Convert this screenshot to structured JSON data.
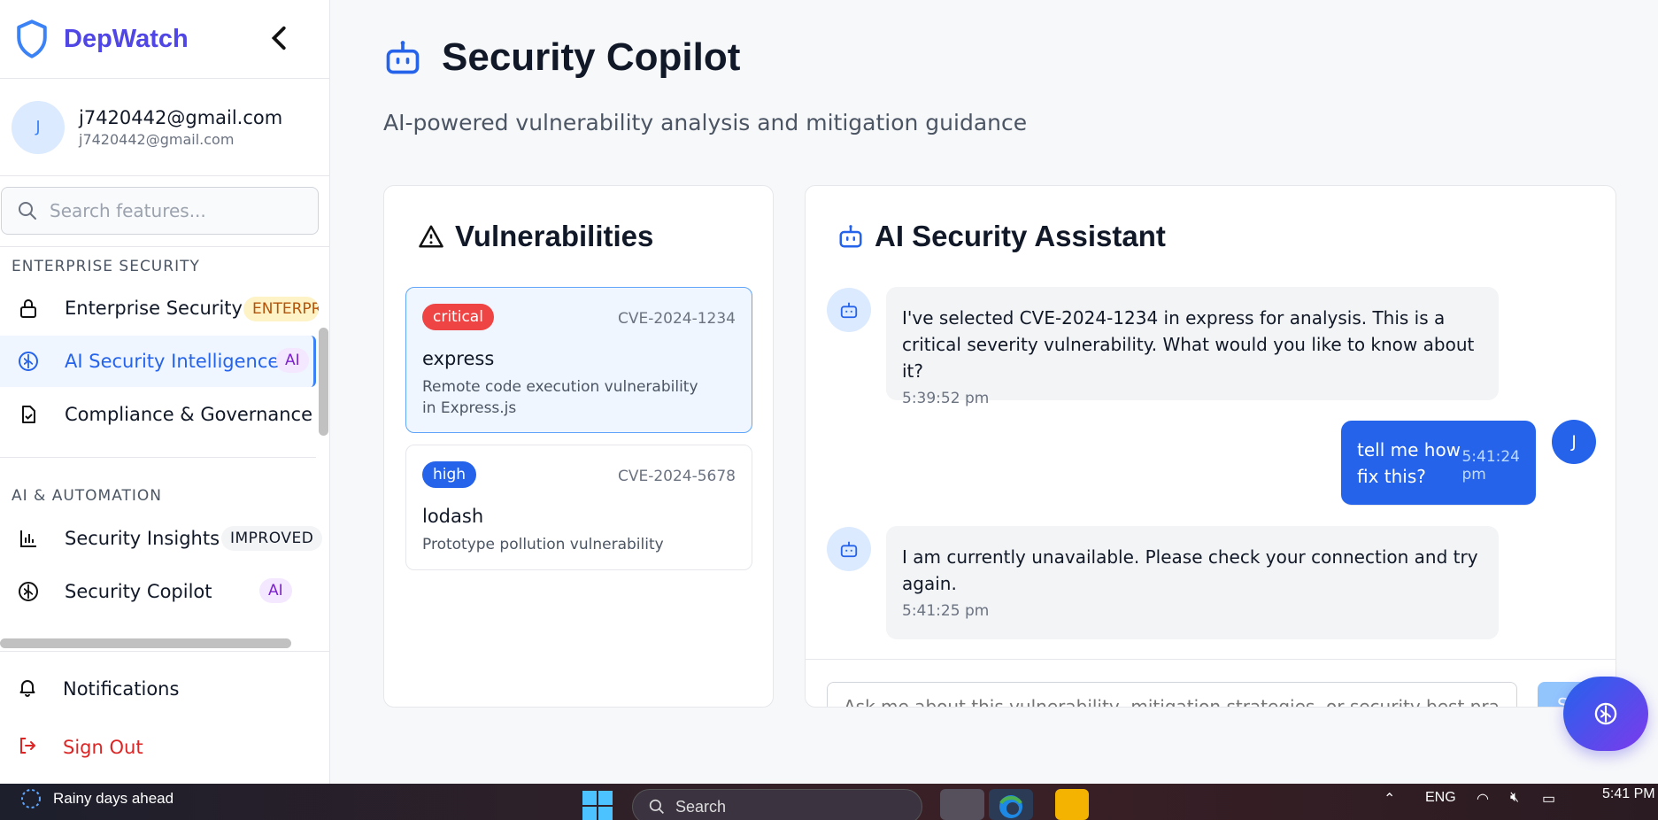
{
  "app": {
    "name": "DepWatch"
  },
  "user": {
    "avatar_initial": "J",
    "name": "j7420442@gmail.com",
    "email": "j7420442@gmail.com"
  },
  "search": {
    "placeholder": "Search features..."
  },
  "sidebar": {
    "sections": [
      {
        "title": "ENTERPRISE SECURITY"
      },
      {
        "title": "AI & AUTOMATION"
      }
    ],
    "items": [
      {
        "label": "Enterprise Security",
        "icon": "lock-icon",
        "badge": "ENTERPRISE"
      },
      {
        "label": "AI Security Intelligence",
        "icon": "brain-icon",
        "badge": "AI",
        "active": true
      },
      {
        "label": "Compliance & Governance",
        "icon": "file-check-icon"
      },
      {
        "label": "Security Insights",
        "icon": "bar-chart-icon",
        "badge": "IMPROVED"
      },
      {
        "label": "Security Copilot",
        "icon": "brain-icon",
        "badge": "AI"
      }
    ],
    "bottom": [
      {
        "label": "Notifications",
        "icon": "bell-icon"
      },
      {
        "label": "Sign Out",
        "icon": "sign-out-icon"
      }
    ]
  },
  "page": {
    "title": "Security Copilot",
    "subtitle": "AI-powered vulnerability analysis and mitigation guidance"
  },
  "vulnerabilities": {
    "title": "Vulnerabilities",
    "items": [
      {
        "severity": "critical",
        "cve": "CVE-2024-1234",
        "package": "express",
        "description": "Remote code execution vulnerability in Express.js",
        "selected": true
      },
      {
        "severity": "high",
        "cve": "CVE-2024-5678",
        "package": "lodash",
        "description": "Prototype pollution vulnerability",
        "selected": false
      }
    ]
  },
  "assistant": {
    "title": "AI Security Assistant",
    "messages": [
      {
        "role": "assistant",
        "text": "I've selected CVE-2024-1234 in express for analysis. This is a critical severity vulnerability. What would you like to know about it?",
        "time": "5:39:52 pm"
      },
      {
        "role": "user",
        "text": "tell me how fix this?",
        "time": "5:41:24 pm",
        "avatar_initial": "J"
      },
      {
        "role": "assistant",
        "text": "I am currently unavailable. Please check your connection and try again.",
        "time": "5:41:25 pm"
      }
    ],
    "input_placeholder": "Ask me about this vulnerability, mitigation strategies, or security best practices...",
    "send_label": "Send"
  },
  "taskbar": {
    "weather": "Rainy days ahead",
    "search_placeholder": "Search",
    "language": "ENG",
    "time": "5:41 PM"
  },
  "colors": {
    "accent": "#2563eb",
    "critical": "#ef4444",
    "high": "#2563eb",
    "sign_out": "#dc2626",
    "brand": "#4f46e5"
  }
}
